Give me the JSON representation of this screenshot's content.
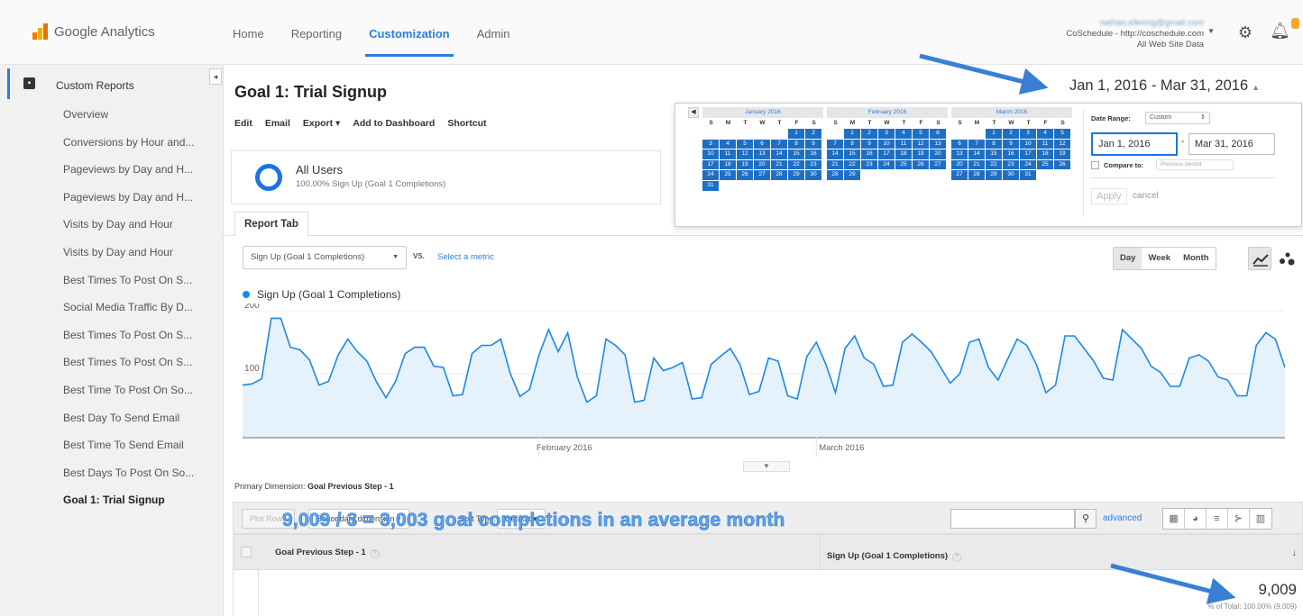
{
  "app": {
    "name": "Google Analytics"
  },
  "topnav": [
    "Home",
    "Reporting",
    "Customization",
    "Admin"
  ],
  "account": {
    "email": "nathan.ellering@gmail.com",
    "property": "CoSchedule - http://coschedule.com",
    "view": "All Web Site Data"
  },
  "sidebar": {
    "header": "Custom Reports",
    "items": [
      "Overview",
      "Conversions by Hour and...",
      "Pageviews by Day and H...",
      "Pageviews by Day and H...",
      "Visits by Day and Hour",
      "Visits by Day and Hour",
      "Best Times To Post On S...",
      "Social Media Traffic By D...",
      "Best Times To Post On S...",
      "Best Times To Post On S...",
      "Best Time To Post On So...",
      "Best Day To Send Email",
      "Best Time To Send Email",
      "Best Days To Post On So...",
      "Goal 1: Trial Signup"
    ]
  },
  "report": {
    "title": "Goal 1: Trial Signup",
    "actions": [
      "Edit",
      "Email",
      "Export ▾",
      "Add to Dashboard",
      "Shortcut"
    ],
    "date_range": "Jan 1, 2016 - Mar 31, 2016"
  },
  "segment": {
    "name": "All Users",
    "sub": "100.00% Sign Up (Goal 1 Completions)"
  },
  "tab": "Report Tab",
  "chart_controls": {
    "metric": "Sign Up (Goal 1 Completions)",
    "vs": "VS.",
    "select_metric": "Select a metric",
    "granularity": [
      "Day",
      "Week",
      "Month"
    ]
  },
  "chart_data": {
    "type": "area",
    "series": [
      {
        "name": "Sign Up (Goal 1 Completions)",
        "values": [
          82,
          84,
          92,
          188,
          188,
          142,
          138,
          122,
          82,
          88,
          130,
          155,
          135,
          120,
          87,
          62,
          88,
          132,
          142,
          142,
          112,
          110,
          65,
          67,
          132,
          145,
          145,
          155,
          100,
          64,
          75,
          130,
          170,
          135,
          165,
          95,
          55,
          65,
          155,
          145,
          130,
          55,
          58,
          125,
          105,
          110,
          118,
          60,
          62,
          115,
          128,
          140,
          115,
          67,
          72,
          125,
          120,
          65,
          60,
          127,
          150,
          115,
          70,
          140,
          160,
          125,
          115,
          80,
          82,
          150,
          163,
          150,
          135,
          110,
          85,
          100,
          150,
          155,
          110,
          90,
          123,
          155,
          145,
          115,
          70,
          82,
          160,
          160,
          140,
          120,
          93,
          90,
          170,
          155,
          140,
          112,
          102,
          80,
          80,
          125,
          130,
          120,
          95,
          90,
          65,
          65,
          145,
          165,
          155,
          110
        ]
      }
    ],
    "x_labels": [
      "February 2016",
      "March 2016"
    ],
    "y_ticks": [
      100,
      200
    ],
    "ylim": [
      0,
      200
    ],
    "color": "#1e88e5"
  },
  "table": {
    "primary_dimension_label": "Primary Dimension:",
    "primary_dimension": "Goal Previous Step - 1",
    "plot_rows": "Plot Rows",
    "secondary_dimension": "Secondary dimension ▾",
    "sort_type_label": "Sort Type:",
    "sort_type": "Default ▾",
    "advanced": "advanced",
    "col1": "Goal Previous Step - 1",
    "col2": "Sign Up (Goal 1 Completions)",
    "total": "9,009",
    "total_pct": "% of Total: 100.00% (9,009)"
  },
  "annotation": "9,009 / 3 = 3,003 goal completions in an average month",
  "calendar": {
    "months": [
      {
        "title": "January 2016",
        "offset": 5,
        "days": 31
      },
      {
        "title": "February 2016",
        "offset": 1,
        "days": 29
      },
      {
        "title": "March 2016",
        "offset": 2,
        "days": 31
      }
    ],
    "dow": [
      "S",
      "M",
      "T",
      "W",
      "T",
      "F",
      "S"
    ],
    "date_range_label": "Date Range:",
    "date_range_mode": "Custom",
    "start": "Jan 1, 2016",
    "end": "Mar 31, 2016",
    "compare_label": "Compare to:",
    "compare_value": "Previous period",
    "apply": "Apply",
    "cancel": "cancel"
  },
  "colors": {
    "accent": "#2a7de1",
    "calendar_day": "#1e6fc4",
    "annotation": "#5da5f0"
  }
}
